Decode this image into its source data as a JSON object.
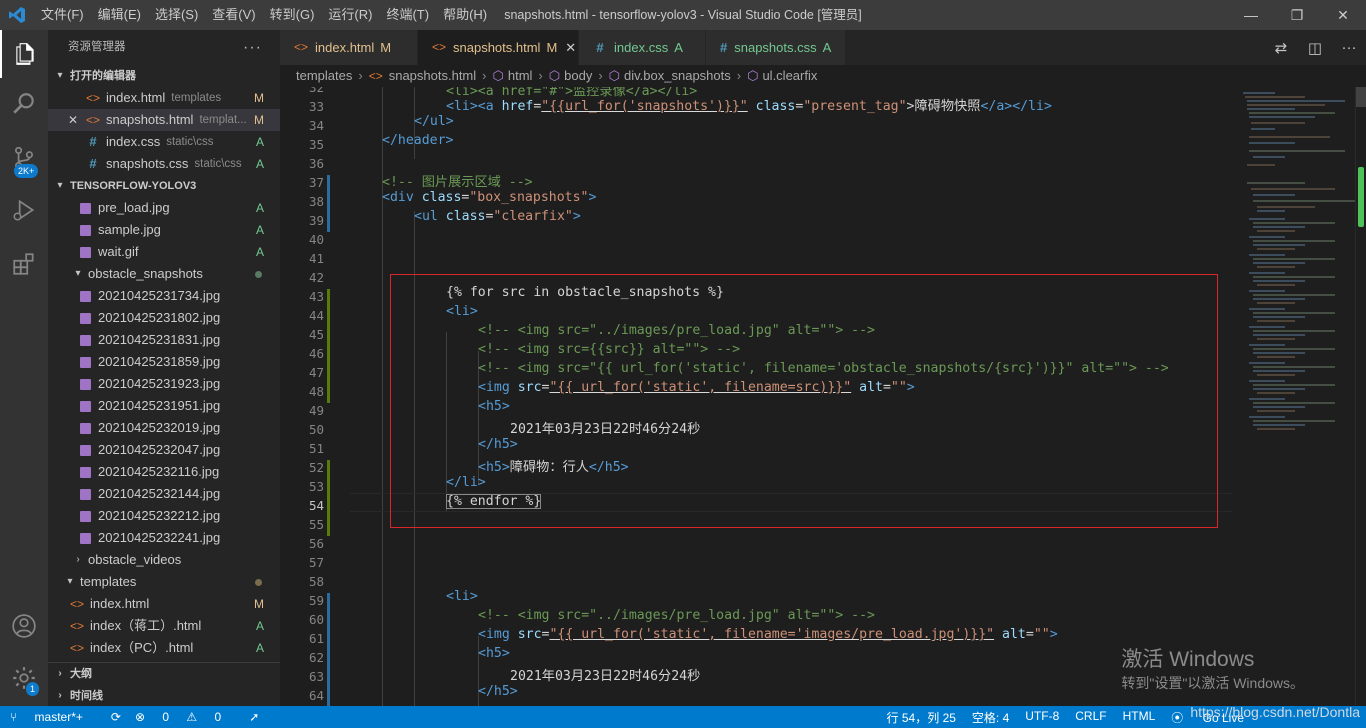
{
  "window": {
    "title": "snapshots.html - tensorflow-yolov3 - Visual Studio Code [管理员]",
    "menu": [
      "文件(F)",
      "编辑(E)",
      "选择(S)",
      "查看(V)",
      "转到(G)",
      "运行(R)",
      "终端(T)",
      "帮助(H)"
    ]
  },
  "activity": {
    "scm_badge": "2K+",
    "settings_badge": "1"
  },
  "sidebar": {
    "title": "资源管理器",
    "open_editors_header": "打开的编辑器",
    "open_editors": [
      {
        "name": "index.html",
        "hint": "templates",
        "status": "M",
        "icon": "html"
      },
      {
        "name": "snapshots.html",
        "hint": "templat...",
        "status": "M",
        "icon": "html",
        "close": "✕"
      },
      {
        "name": "index.css",
        "hint": "static\\css",
        "status": "A",
        "icon": "css"
      },
      {
        "name": "snapshots.css",
        "hint": "static\\css",
        "status": "A",
        "icon": "css"
      }
    ],
    "project_header": "TENSORFLOW-YOLOV3",
    "files_top": [
      {
        "name": "pre_load.jpg",
        "status": "A"
      },
      {
        "name": "sample.jpg",
        "status": "A"
      },
      {
        "name": "wait.gif",
        "status": "A"
      }
    ],
    "folder_snapshots": "obstacle_snapshots",
    "snapshots": [
      "20210425231734.jpg",
      "20210425231802.jpg",
      "20210425231831.jpg",
      "20210425231859.jpg",
      "20210425231923.jpg",
      "20210425231951.jpg",
      "20210425232019.jpg",
      "20210425232047.jpg",
      "20210425232116.jpg",
      "20210425232144.jpg",
      "20210425232212.jpg",
      "20210425232241.jpg"
    ],
    "folder_videos": "obstacle_videos",
    "folder_templates": "templates",
    "templates": [
      {
        "name": "index.html",
        "status": "M"
      },
      {
        "name": "index（蒋工）.html",
        "status": "A"
      },
      {
        "name": "index（PC）.html",
        "status": "A"
      }
    ],
    "outline": "大纲",
    "timeline": "时间线"
  },
  "tabs": [
    {
      "label": "index.html",
      "status": "M",
      "icon": "html"
    },
    {
      "label": "snapshots.html",
      "status": "M",
      "icon": "html",
      "active": true,
      "close": "✕"
    },
    {
      "label": "index.css",
      "status": "A",
      "icon": "css"
    },
    {
      "label": "snapshots.css",
      "status": "A",
      "icon": "css"
    }
  ],
  "breadcrumb": [
    "templates",
    "snapshots.html",
    "html",
    "body",
    "div.box_snapshots",
    "ul.clearfix"
  ],
  "code": [
    {
      "n": "32",
      "cur": false
    },
    {
      "n": "33"
    },
    {
      "n": "34"
    },
    {
      "n": "35"
    },
    {
      "n": "36"
    },
    {
      "n": "37"
    },
    {
      "n": "38"
    },
    {
      "n": "39"
    },
    {
      "n": "40"
    },
    {
      "n": "41"
    },
    {
      "n": "42"
    },
    {
      "n": "43"
    },
    {
      "n": "44"
    },
    {
      "n": "45"
    },
    {
      "n": "46"
    },
    {
      "n": "47"
    },
    {
      "n": "48"
    },
    {
      "n": "49"
    },
    {
      "n": "50"
    },
    {
      "n": "51"
    },
    {
      "n": "52"
    },
    {
      "n": "53"
    },
    {
      "n": "54"
    },
    {
      "n": "55"
    },
    {
      "n": "56"
    },
    {
      "n": "57"
    },
    {
      "n": "58"
    },
    {
      "n": "59"
    },
    {
      "n": "60"
    },
    {
      "n": "61"
    },
    {
      "n": "62"
    },
    {
      "n": "63"
    },
    {
      "n": "64"
    }
  ],
  "lines": {
    "l32": "<li><a href=\"#\">监控录像</a></li>",
    "l33a": "<li><a ",
    "l33b": "href",
    "l33c": "=",
    "l33d": "\"{{url_for('snapshots')}}\"",
    "l33e": " class",
    "l33f": "=",
    "l33g": "\"present_tag\"",
    "l33h": ">障碍物快照",
    "l33i": "</a></li>",
    "l34": "</ul>",
    "l35": "</header>",
    "l37": "<!-- 图片展示区域 -->",
    "l38a": "<div ",
    "l38b": "class",
    "l38c": "=",
    "l38d": "\"box_snapshots\"",
    "l38e": ">",
    "l39a": "<ul ",
    "l39b": "class",
    "l39c": "=",
    "l39d": "\"clearfix\"",
    "l39e": ">",
    "l43": "{% for src in obstacle_snapshots %}",
    "l44": "<li>",
    "l45": "<!-- <img src=\"../images/pre_load.jpg\" alt=\"\"> -->",
    "l46": "<!-- <img src={{src}} alt=\"\"> -->",
    "l47": "<!-- <img src=\"{{ url_for('static', filename='obstacle_snapshots/{src}')}}\" alt=\"\"> -->",
    "l48a": "<img ",
    "l48b": "src",
    "l48c": "=",
    "l48d": "\"{{ url_for('static', filename=src)}}\"",
    "l48e": " alt",
    "l48f": "=",
    "l48g": "\"\"",
    "l48h": ">",
    "l49": "<h5>",
    "l50": "2021年03月23日22时46分24秒",
    "l51": "</h5>",
    "l52a": "<h5>",
    "l52b": "障碍物：行人",
    "l52c": "</h5>",
    "l53": "</li>",
    "l54": "{% endfor %}",
    "l59": "<li>",
    "l60": "<!-- <img src=\"../images/pre_load.jpg\" alt=\"\"> -->",
    "l61a": "<img ",
    "l61b": "src",
    "l61c": "=",
    "l61d": "\"{{ url_for('static', filename='images/pre_load.jpg')}}\"",
    "l61e": " alt",
    "l61f": "=",
    "l61g": "\"\"",
    "l61h": ">",
    "l62": "<h5>",
    "l63": "2021年03月23日22时46分24秒",
    "l64": "</h5>"
  },
  "status": {
    "branch": "master*+",
    "errors": "0",
    "warnings": "0",
    "position": "行 54，列 25",
    "spaces": "空格: 4",
    "encoding": "UTF-8",
    "eol": "CRLF",
    "lang": "HTML",
    "golive": "Go Live"
  },
  "watermark": {
    "line1": "激活 Windows",
    "line2": "转到\"设置\"以激活 Windows。",
    "csdn": "https://blog.csdn.net/Dontla"
  }
}
